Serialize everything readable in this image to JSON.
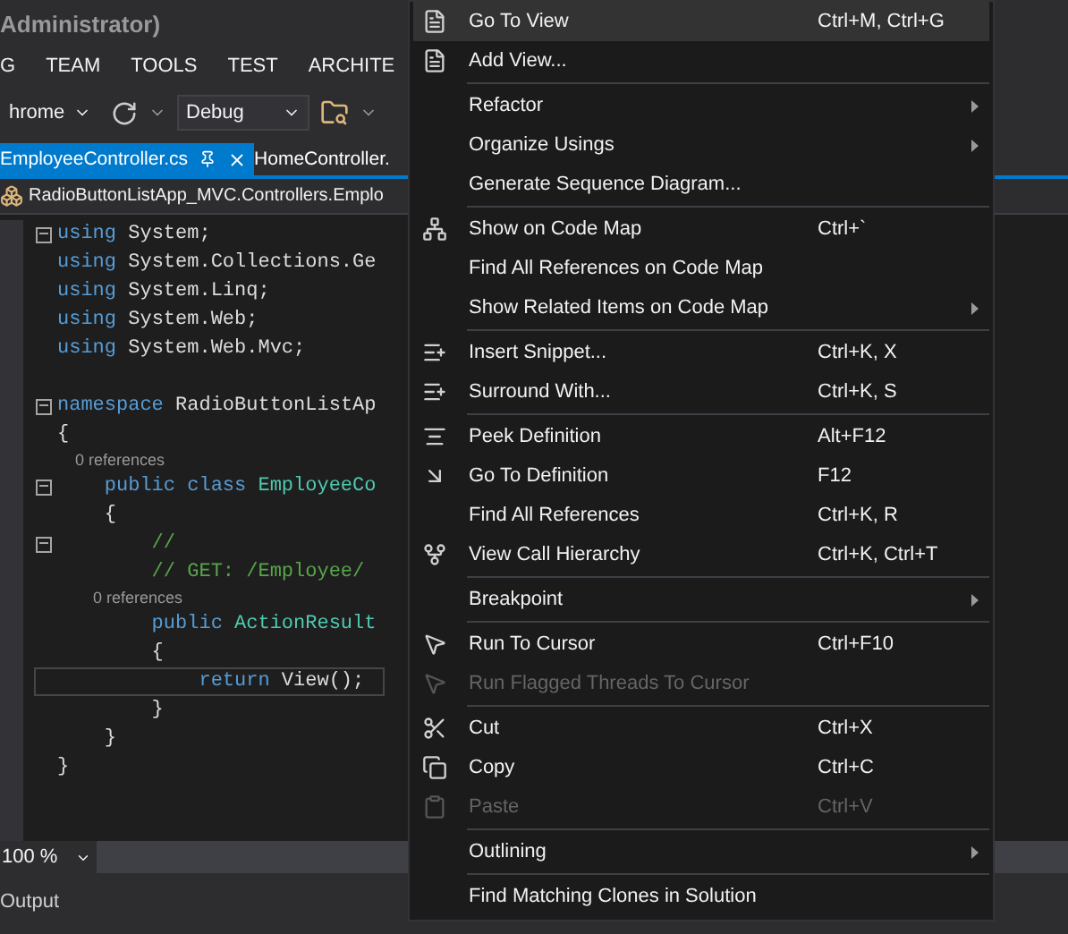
{
  "window": {
    "title": "Administrator)"
  },
  "menu_bar": [
    "G",
    "TEAM",
    "TOOLS",
    "TEST",
    "ARCHITE"
  ],
  "toolbar": {
    "browser": "hrome",
    "configuration": "Debug"
  },
  "tabs": [
    {
      "label": "EmployeeController.cs",
      "selected": true
    },
    {
      "label": "HomeController.",
      "selected": false
    }
  ],
  "navigation_bar": {
    "path": "RadioButtonListApp_MVC.Controllers.Emplo"
  },
  "code": {
    "lines": [
      {
        "kind": "code",
        "fold": true,
        "current": false,
        "tokens": [
          {
            "kind": "keyword",
            "text": "using"
          },
          {
            "kind": "plain",
            "text": " System;"
          }
        ]
      },
      {
        "kind": "code",
        "fold": false,
        "current": false,
        "tokens": [
          {
            "kind": "keyword",
            "text": "using"
          },
          {
            "kind": "plain",
            "text": " System.Collections.Ge"
          }
        ]
      },
      {
        "kind": "code",
        "fold": false,
        "current": false,
        "tokens": [
          {
            "kind": "keyword",
            "text": "using"
          },
          {
            "kind": "plain",
            "text": " System.Linq;"
          }
        ]
      },
      {
        "kind": "code",
        "fold": false,
        "current": false,
        "tokens": [
          {
            "kind": "keyword",
            "text": "using"
          },
          {
            "kind": "plain",
            "text": " System.Web;"
          }
        ]
      },
      {
        "kind": "code",
        "fold": false,
        "current": false,
        "tokens": [
          {
            "kind": "keyword",
            "text": "using"
          },
          {
            "kind": "plain",
            "text": " System.Web.Mvc;"
          }
        ]
      },
      {
        "kind": "blank",
        "fold": false,
        "current": false
      },
      {
        "kind": "code",
        "fold": true,
        "current": false,
        "tokens": [
          {
            "kind": "keyword",
            "text": "namespace"
          },
          {
            "kind": "plain",
            "text": " RadioButtonListAp"
          }
        ]
      },
      {
        "kind": "code",
        "fold": false,
        "current": false,
        "tokens": [
          {
            "kind": "plain",
            "text": "{"
          }
        ]
      },
      {
        "kind": "lens",
        "fold": false,
        "current": false,
        "tokens": [
          {
            "kind": "lens",
            "text": "    0 references"
          }
        ]
      },
      {
        "kind": "code",
        "fold": true,
        "current": false,
        "tokens": [
          {
            "kind": "keyword",
            "text": "    public class"
          },
          {
            "kind": "type",
            "text": " EmployeeCo"
          }
        ]
      },
      {
        "kind": "code",
        "fold": false,
        "current": false,
        "tokens": [
          {
            "kind": "plain",
            "text": "    {"
          }
        ]
      },
      {
        "kind": "code",
        "fold": true,
        "current": false,
        "tokens": [
          {
            "kind": "comment",
            "text": "        //"
          }
        ]
      },
      {
        "kind": "code",
        "fold": false,
        "current": false,
        "tokens": [
          {
            "kind": "comment",
            "text": "        // GET: /Employee/"
          }
        ]
      },
      {
        "kind": "lens",
        "fold": false,
        "current": false,
        "tokens": [
          {
            "kind": "lens",
            "text": "        0 references"
          }
        ]
      },
      {
        "kind": "code",
        "fold": false,
        "current": false,
        "tokens": [
          {
            "kind": "keyword",
            "text": "        public"
          },
          {
            "kind": "type",
            "text": " ActionResult"
          }
        ]
      },
      {
        "kind": "code",
        "fold": false,
        "current": false,
        "tokens": [
          {
            "kind": "plain",
            "text": "        {"
          }
        ]
      },
      {
        "kind": "code",
        "fold": false,
        "current": true,
        "tokens": [
          {
            "kind": "keyword",
            "text": "            return"
          },
          {
            "kind": "plain",
            "text": " View();"
          }
        ]
      },
      {
        "kind": "code",
        "fold": false,
        "current": false,
        "tokens": [
          {
            "kind": "plain",
            "text": "        }"
          }
        ]
      },
      {
        "kind": "code",
        "fold": false,
        "current": false,
        "tokens": [
          {
            "kind": "plain",
            "text": "    }"
          }
        ]
      },
      {
        "kind": "code",
        "fold": false,
        "current": false,
        "tokens": [
          {
            "kind": "plain",
            "text": "}"
          }
        ]
      }
    ]
  },
  "zoom": {
    "value": "100 %"
  },
  "output_panel": {
    "title": "Output"
  },
  "context_menu": {
    "groups": [
      [
        {
          "label": "Go To View",
          "shortcut": "Ctrl+M, Ctrl+G",
          "submenu": false,
          "disabled": false,
          "selected": true
        },
        {
          "label": "Add View...",
          "submenu": false,
          "disabled": false,
          "selected": false
        }
      ],
      [
        {
          "label": "Refactor",
          "submenu": true,
          "disabled": false,
          "selected": false
        },
        {
          "label": "Organize Usings",
          "submenu": true,
          "disabled": false,
          "selected": false
        },
        {
          "label": "Generate Sequence Diagram...",
          "submenu": false,
          "disabled": false,
          "selected": false
        }
      ],
      [
        {
          "label": "Show on Code Map",
          "shortcut": "Ctrl+`",
          "submenu": false,
          "disabled": false,
          "selected": false
        },
        {
          "label": "Find All References on Code Map",
          "submenu": false,
          "disabled": false,
          "selected": false
        },
        {
          "label": "Show Related Items on Code Map",
          "submenu": true,
          "disabled": false,
          "selected": false
        }
      ],
      [
        {
          "label": "Insert Snippet...",
          "shortcut": "Ctrl+K, X",
          "submenu": false,
          "disabled": false,
          "selected": false
        },
        {
          "label": "Surround With...",
          "shortcut": "Ctrl+K, S",
          "submenu": false,
          "disabled": false,
          "selected": false
        }
      ],
      [
        {
          "label": "Peek Definition",
          "shortcut": "Alt+F12",
          "submenu": false,
          "disabled": false,
          "selected": false
        },
        {
          "label": "Go To Definition",
          "shortcut": "F12",
          "submenu": false,
          "disabled": false,
          "selected": false
        },
        {
          "label": "Find All References",
          "shortcut": "Ctrl+K, R",
          "submenu": false,
          "disabled": false,
          "selected": false
        },
        {
          "label": "View Call Hierarchy",
          "shortcut": "Ctrl+K, Ctrl+T",
          "submenu": false,
          "disabled": false,
          "selected": false
        }
      ],
      [
        {
          "label": "Breakpoint",
          "submenu": true,
          "disabled": false,
          "selected": false
        }
      ],
      [
        {
          "label": "Run To Cursor",
          "shortcut": "Ctrl+F10",
          "submenu": false,
          "disabled": false,
          "selected": false
        },
        {
          "label": "Run Flagged Threads To Cursor",
          "submenu": false,
          "disabled": true,
          "selected": false
        }
      ],
      [
        {
          "label": "Cut",
          "shortcut": "Ctrl+X",
          "submenu": false,
          "disabled": false,
          "selected": false
        },
        {
          "label": "Copy",
          "shortcut": "Ctrl+C",
          "submenu": false,
          "disabled": false,
          "selected": false
        },
        {
          "label": "Paste",
          "shortcut": "Ctrl+V",
          "submenu": false,
          "disabled": true,
          "selected": false
        }
      ],
      [
        {
          "label": "Outlining",
          "submenu": true,
          "disabled": false,
          "selected": false
        }
      ],
      [
        {
          "label": "Find Matching Clones in Solution",
          "submenu": false,
          "disabled": false,
          "selected": false
        }
      ]
    ]
  }
}
